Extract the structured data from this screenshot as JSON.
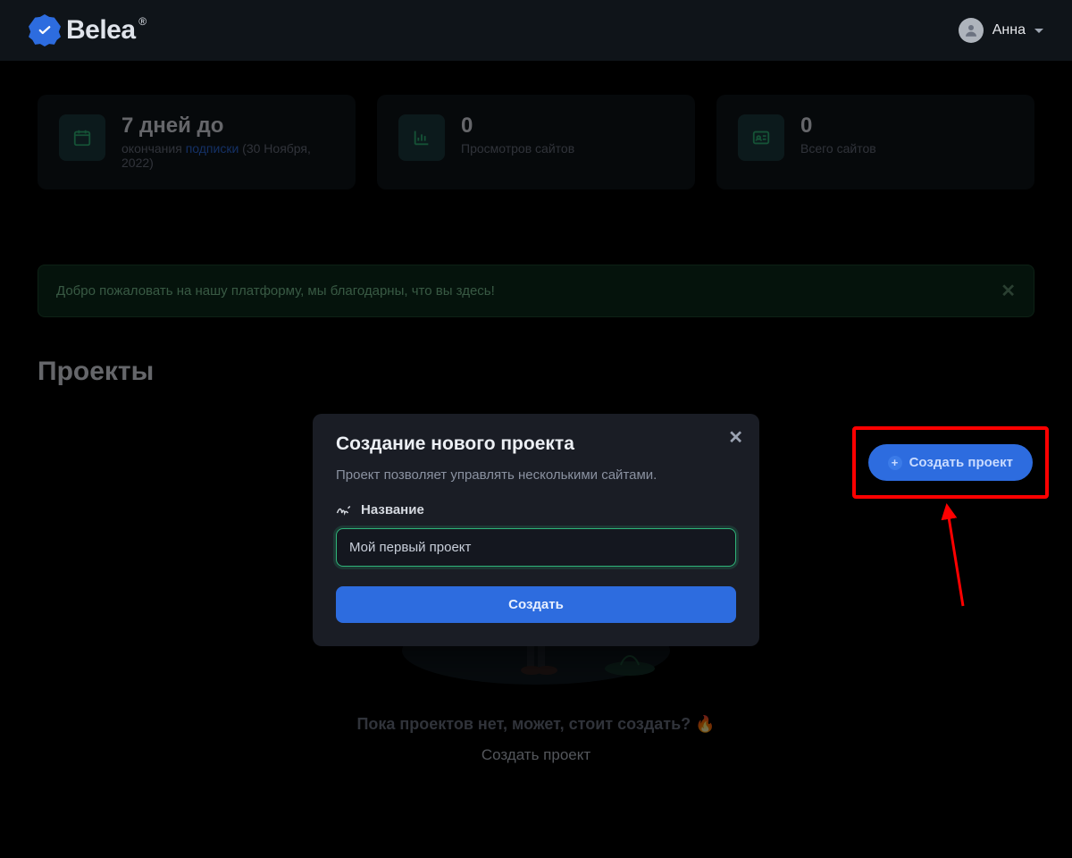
{
  "header": {
    "brand": "Belea",
    "user_name": "Анна"
  },
  "stats": {
    "subscription": {
      "value": "7 дней до",
      "prefix": "окончания ",
      "link": "подписки",
      "suffix": " (30 Ноября, 2022)"
    },
    "views": {
      "value": "0",
      "label": "Просмотров сайтов"
    },
    "sites": {
      "value": "0",
      "label": "Всего сайтов"
    }
  },
  "alert": {
    "text": "Добро пожаловать на нашу платформу, мы благодарны, что вы здесь!"
  },
  "projects": {
    "heading": "Проекты",
    "create_button": "Создать проект",
    "empty_title": "Пока проектов нет, может, стоит создать? 🔥",
    "empty_link": "Создать проект"
  },
  "modal": {
    "title": "Создание нового проекта",
    "subtitle": "Проект позволяет управлять несколькими сайтами.",
    "field_label": "Название",
    "field_value": "Мой первый проект",
    "submit": "Создать"
  }
}
